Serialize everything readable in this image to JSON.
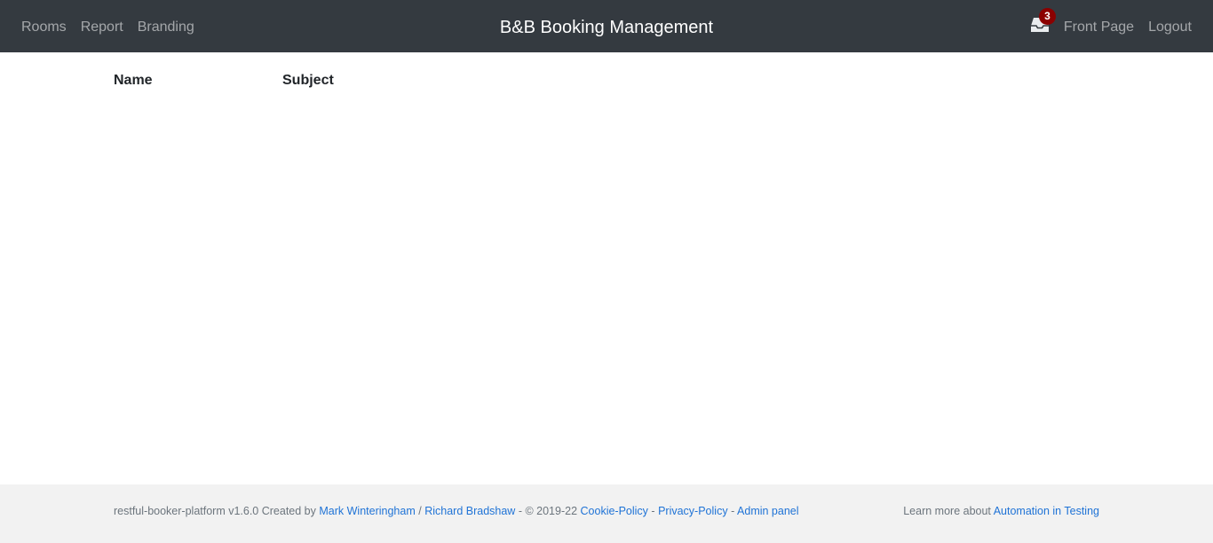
{
  "nav": {
    "rooms": "Rooms",
    "report": "Report",
    "branding": "Branding",
    "brand": "B&B Booking Management",
    "inbox_count": "3",
    "front_page": "Front Page",
    "logout": "Logout"
  },
  "messages": {
    "columns": [
      "Name",
      "Subject"
    ]
  },
  "footer": {
    "version_text": "restful-booker-platform v1.6.0 Created by",
    "author1": "Mark Winteringham",
    "slash": "/",
    "author2": "Richard Bradshaw",
    "copyright": "- © 2019-22",
    "cookie_policy": "Cookie-Policy",
    "dash1": "-",
    "privacy_policy": "Privacy-Policy",
    "dash2": "-",
    "admin_panel": "Admin panel",
    "learn_more": "Learn more about",
    "automation_link": "Automation in Testing"
  },
  "colors": {
    "navbar_bg": "#343a40",
    "badge_bg": "#8b0000",
    "link": "#1f73d6",
    "footer_bg": "#f2f2f2"
  },
  "icons": {
    "inbox": "inbox-icon"
  }
}
